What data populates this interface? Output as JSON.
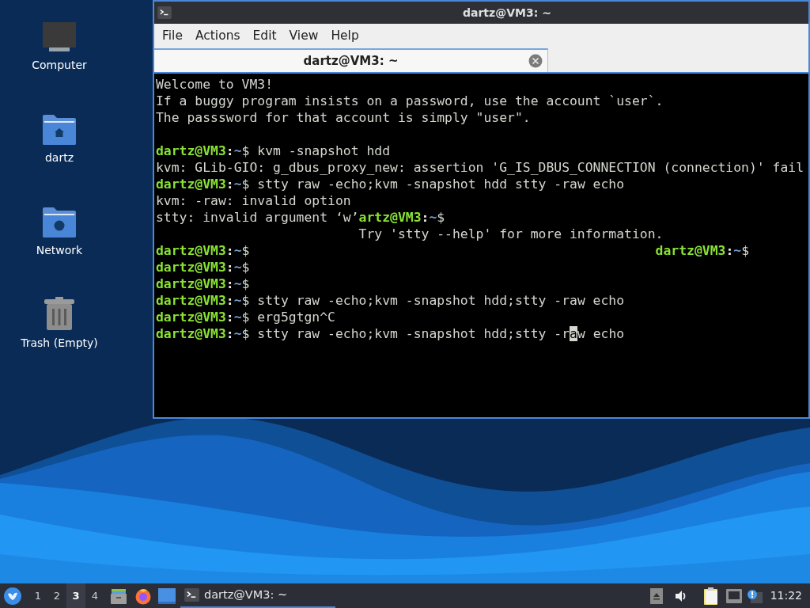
{
  "desktop_icons": [
    {
      "label": "Computer",
      "kind": "computer"
    },
    {
      "label": "dartz",
      "kind": "home_folder"
    },
    {
      "label": "Network",
      "kind": "network_folder"
    },
    {
      "label": "Trash (Empty)",
      "kind": "trash"
    }
  ],
  "window": {
    "title": "dartz@VM3: ~",
    "menu": [
      "File",
      "Actions",
      "Edit",
      "View",
      "Help"
    ],
    "tabs": [
      {
        "label": "dartz@VM3: ~",
        "selected": true
      }
    ],
    "terminal_lines": [
      {
        "kind": "output",
        "segments": [
          {
            "kind": "text",
            "text": "Welcome to VM3!"
          }
        ]
      },
      {
        "kind": "output",
        "segments": [
          {
            "kind": "text",
            "text": "If a buggy program insists on a password, use the account `user`."
          }
        ]
      },
      {
        "kind": "output",
        "segments": [
          {
            "kind": "text",
            "text": "The passsword for that account is simply \"user\"."
          }
        ]
      },
      {
        "kind": "blank"
      },
      {
        "kind": "output",
        "segments": [
          {
            "kind": "user",
            "text": "dartz@VM3"
          },
          {
            "kind": "sep",
            "text": ":"
          },
          {
            "kind": "path",
            "text": "~"
          },
          {
            "kind": "text",
            "text": "$ kvm -snapshot hdd"
          }
        ]
      },
      {
        "kind": "output",
        "segments": [
          {
            "kind": "text",
            "text": "kvm: GLib-GIO: g_dbus_proxy_new: assertion 'G_IS_DBUS_CONNECTION (connection)' fail"
          }
        ]
      },
      {
        "kind": "output",
        "segments": [
          {
            "kind": "user",
            "text": "dartz@VM3"
          },
          {
            "kind": "sep",
            "text": ":"
          },
          {
            "kind": "path",
            "text": "~"
          },
          {
            "kind": "text",
            "text": "$ stty raw -echo;kvm -snapshot hdd stty -raw echo"
          }
        ]
      },
      {
        "kind": "output",
        "segments": [
          {
            "kind": "text",
            "text": "kvm: -raw: invalid option"
          }
        ]
      },
      {
        "kind": "output",
        "segments": [
          {
            "kind": "text",
            "text": "stty: invalid argument ‘w’"
          },
          {
            "kind": "user",
            "text": "artz@VM3"
          },
          {
            "kind": "sep",
            "text": ":"
          },
          {
            "kind": "path",
            "text": "~"
          },
          {
            "kind": "text",
            "text": "$"
          }
        ]
      },
      {
        "kind": "output",
        "segments": [
          {
            "kind": "text",
            "text": "                          Try 'stty --help' for more information."
          }
        ]
      },
      {
        "kind": "output",
        "segments": [
          {
            "kind": "user",
            "text": "dartz@VM3"
          },
          {
            "kind": "sep",
            "text": ":"
          },
          {
            "kind": "path",
            "text": "~"
          },
          {
            "kind": "text",
            "text": "$                                                    "
          },
          {
            "kind": "user",
            "text": "dartz@VM3"
          },
          {
            "kind": "sep",
            "text": ":"
          },
          {
            "kind": "path",
            "text": "~"
          },
          {
            "kind": "text",
            "text": "$"
          }
        ]
      },
      {
        "kind": "output",
        "segments": [
          {
            "kind": "user",
            "text": "dartz@VM3"
          },
          {
            "kind": "sep",
            "text": ":"
          },
          {
            "kind": "path",
            "text": "~"
          },
          {
            "kind": "text",
            "text": "$"
          }
        ]
      },
      {
        "kind": "output",
        "segments": [
          {
            "kind": "user",
            "text": "dartz@VM3"
          },
          {
            "kind": "sep",
            "text": ":"
          },
          {
            "kind": "path",
            "text": "~"
          },
          {
            "kind": "text",
            "text": "$"
          }
        ]
      },
      {
        "kind": "output",
        "segments": [
          {
            "kind": "user",
            "text": "dartz@VM3"
          },
          {
            "kind": "sep",
            "text": ":"
          },
          {
            "kind": "path",
            "text": "~"
          },
          {
            "kind": "text",
            "text": "$ stty raw -echo;kvm -snapshot hdd;stty -raw echo"
          }
        ]
      },
      {
        "kind": "output",
        "segments": [
          {
            "kind": "user",
            "text": "dartz@VM3"
          },
          {
            "kind": "sep",
            "text": ":"
          },
          {
            "kind": "path",
            "text": "~"
          },
          {
            "kind": "text",
            "text": "$ erg5gtgn^C"
          }
        ]
      },
      {
        "kind": "output",
        "segments": [
          {
            "kind": "user",
            "text": "dartz@VM3"
          },
          {
            "kind": "sep",
            "text": ":"
          },
          {
            "kind": "path",
            "text": "~"
          },
          {
            "kind": "text",
            "text": "$ stty raw -echo;kvm -snapshot hdd;stty -r"
          },
          {
            "kind": "cursor",
            "text": "a"
          },
          {
            "kind": "text",
            "text": "w echo"
          }
        ]
      }
    ]
  },
  "taskbar": {
    "workspaces": [
      {
        "label": "1",
        "selected": false
      },
      {
        "label": "2",
        "selected": false
      },
      {
        "label": "3",
        "selected": true
      },
      {
        "label": "4",
        "selected": false
      }
    ],
    "task": {
      "label": "dartz@VM3: ~",
      "selected": true
    },
    "clock": "11:22"
  }
}
